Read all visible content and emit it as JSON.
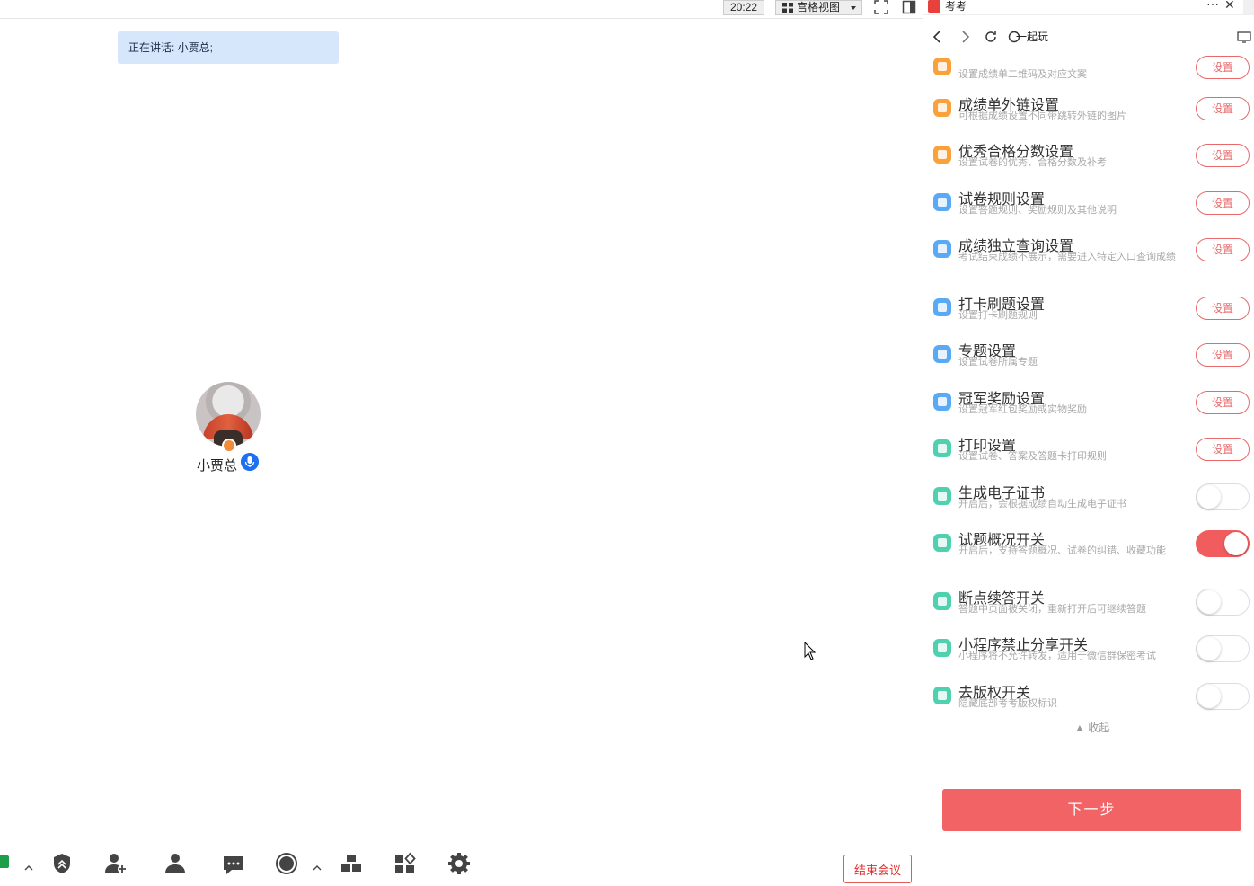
{
  "meeting": {
    "clock": "20:22",
    "view_mode": "宫格视图",
    "speaking_label": "正在讲话: 小贾总;",
    "participant_name": "小贾总",
    "end_button": "结束会议",
    "toolbar_icons": [
      "share-screen-icon",
      "security-icon",
      "invite-icon",
      "participants-icon",
      "chat-icon",
      "record-icon",
      "breakout-rooms-icon",
      "apps-icon",
      "settings-icon"
    ]
  },
  "panel": {
    "app_name": "考考",
    "nav": {
      "game_label": "一起玩"
    },
    "settings": [
      {
        "title": "",
        "desc": "设置成绩单二维码及对应文案",
        "action": "button",
        "action_label": "设置",
        "color": "#f9a13a"
      },
      {
        "title": "成绩单外链设置",
        "desc": "可根据成绩设置不同带跳转外链的图片",
        "action": "button",
        "action_label": "设置",
        "color": "#f9a13a"
      },
      {
        "title": "优秀合格分数设置",
        "desc": "设置试卷的优秀、合格分数及补考",
        "action": "button",
        "action_label": "设置",
        "color": "#f9a13a"
      },
      {
        "title": "试卷规则设置",
        "desc": "设置答题规则、奖励规则及其他说明",
        "action": "button",
        "action_label": "设置",
        "color": "#5aa9f4"
      },
      {
        "title": "成绩独立查询设置",
        "desc": "考试结束成绩不展示，需要进入特定入口查询成绩",
        "action": "button",
        "action_label": "设置",
        "color": "#5aa9f4"
      },
      {
        "title": "打卡刷题设置",
        "desc": "设置打卡刷题规则",
        "action": "button",
        "action_label": "设置",
        "color": "#5aa9f4"
      },
      {
        "title": "专题设置",
        "desc": "设置试卷所属专题",
        "action": "button",
        "action_label": "设置",
        "color": "#5aa9f4"
      },
      {
        "title": "冠军奖励设置",
        "desc": "设置冠军红包奖励或实物奖励",
        "action": "button",
        "action_label": "设置",
        "color": "#5aa9f4"
      },
      {
        "title": "打印设置",
        "desc": "设置试卷、答案及答题卡打印规则",
        "action": "button",
        "action_label": "设置",
        "color": "#4fd1b0"
      },
      {
        "title": "生成电子证书",
        "desc": "开启后，会根据成绩自动生成电子证书",
        "action": "toggle",
        "on": false,
        "color": "#4fd1b0"
      },
      {
        "title": "试题概况开关",
        "desc": "开启后，支持答题概况、试卷的纠错、收藏功能",
        "action": "toggle",
        "on": true,
        "color": "#4fd1b0"
      },
      {
        "title": "断点续答开关",
        "desc": "答题中页面被关闭，重新打开后可继续答题",
        "action": "toggle",
        "on": false,
        "color": "#4fd1b0"
      },
      {
        "title": "小程序禁止分享开关",
        "desc": "小程序将不允许转发，适用于微信群保密考试",
        "action": "toggle",
        "on": false,
        "color": "#4fd1b0"
      },
      {
        "title": "去版权开关",
        "desc": "隐藏底部考考版权标识",
        "action": "toggle",
        "on": false,
        "color": "#4fd1b0"
      }
    ],
    "collapse_label": "▲ 收起",
    "next_button": "下一步"
  }
}
